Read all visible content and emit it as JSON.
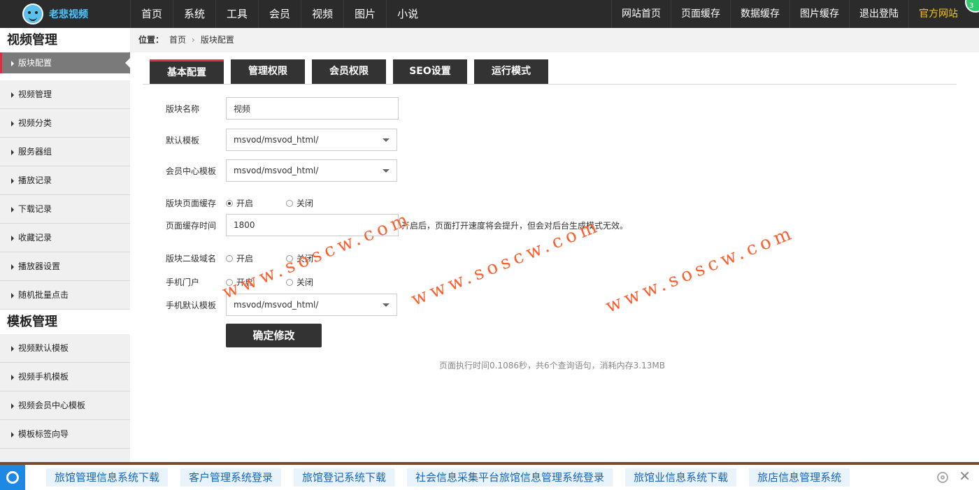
{
  "brand": {
    "name": "老悲视频"
  },
  "nav_left": [
    "首页",
    "系统",
    "工具",
    "会员",
    "视频",
    "图片",
    "小说"
  ],
  "nav_right": [
    "网站首页",
    "页面缓存",
    "数据缓存",
    "图片缓存",
    "退出登陆",
    "官方网站"
  ],
  "corner_badge": "3",
  "sidebar": {
    "section1": "视频管理",
    "section1_items": [
      "版块配置",
      "视频管理",
      "视频分类",
      "服务器组",
      "播放记录",
      "下载记录",
      "收藏记录",
      "播放器设置",
      "随机批量点击"
    ],
    "section2": "模板管理",
    "section2_items": [
      "视频默认模板",
      "视频手机模板",
      "视频会员中心模板",
      "模板标签向导"
    ]
  },
  "breadcrumb": {
    "label": "位置：",
    "home": "首页",
    "sep": "›",
    "current": "版块配置"
  },
  "tabs": [
    "基本配置",
    "管理权限",
    "会员权限",
    "SEO设置",
    "运行模式"
  ],
  "form": {
    "block_name": {
      "label": "版块名称",
      "value": "视频"
    },
    "default_template": {
      "label": "默认模板",
      "value": "msvod/msvod_html/"
    },
    "member_template": {
      "label": "会员中心模板",
      "value": "msvod/msvod_html/"
    },
    "page_cache": {
      "label": "版块页面缓存",
      "on": "开启",
      "off": "关闭"
    },
    "cache_time": {
      "label": "页面缓存时间",
      "value": "1800",
      "hint": "开启后，页面打开速度将会提升，但会对后台生成模式无效。"
    },
    "subdomain": {
      "label": "版块二级域名",
      "on": "开启",
      "off": "关闭"
    },
    "mobile_portal": {
      "label": "手机门户",
      "on": "开启",
      "off": "关闭"
    },
    "mobile_template": {
      "label": "手机默认模板",
      "value": "msvod/msvod_html/"
    },
    "submit": "确定修改"
  },
  "exec_info": "页面执行时间0.1086秒，共6个查询语句，消耗内存3.13MB",
  "watermark": "www.soscw.com",
  "bottom_links": [
    "旅馆管理信息系统下载",
    "客户管理系统登录",
    "旅馆登记系统下载",
    "社会信息采集平台旅馆信息管理系统登录",
    "旅馆业信息系统下载",
    "旅店信息管理系统"
  ],
  "close_glyph": "✕",
  "colors": {
    "topbar": "#2b2b2b",
    "accent_red": "#e02a3f",
    "official_link": "#f5c518",
    "watermark": "#ff5722",
    "bottom_link": "#1565c0"
  }
}
